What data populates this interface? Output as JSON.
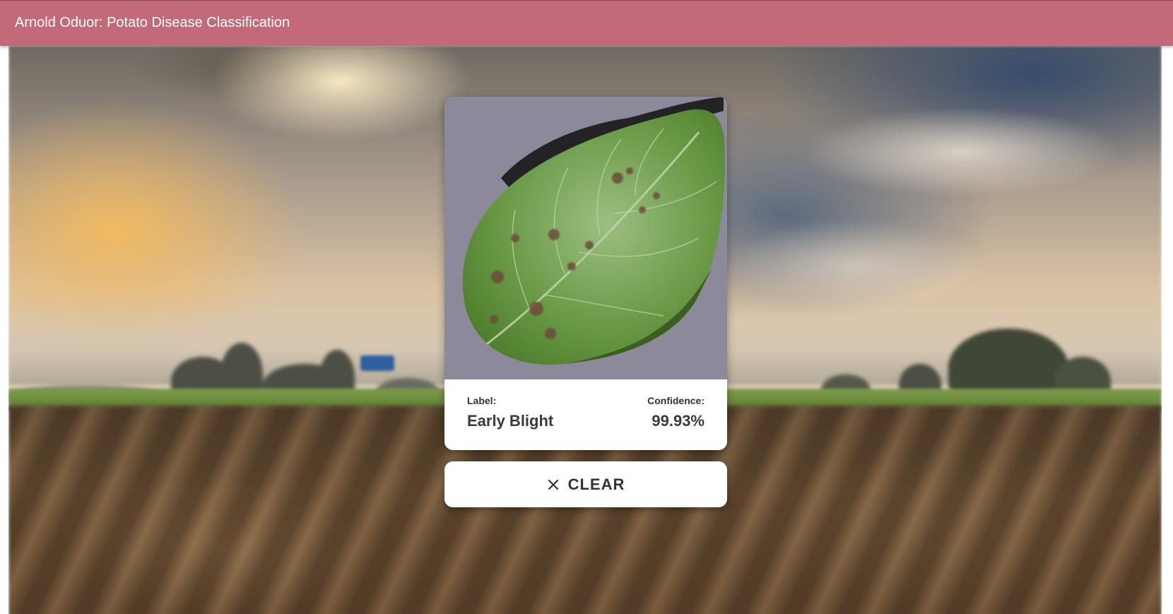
{
  "appbar": {
    "title": "Arnold Oduor: Potato Disease Classification",
    "color": "#c26a79"
  },
  "background": {
    "description_icon": "farm-field-background"
  },
  "result_card": {
    "image_icon": "potato-leaf-image",
    "label_caption": "Label:",
    "label_value": "Early Blight",
    "confidence_caption": "Confidence:",
    "confidence_value": "99.93%"
  },
  "clear_button": {
    "icon": "close-icon",
    "label": "CLEAR"
  }
}
